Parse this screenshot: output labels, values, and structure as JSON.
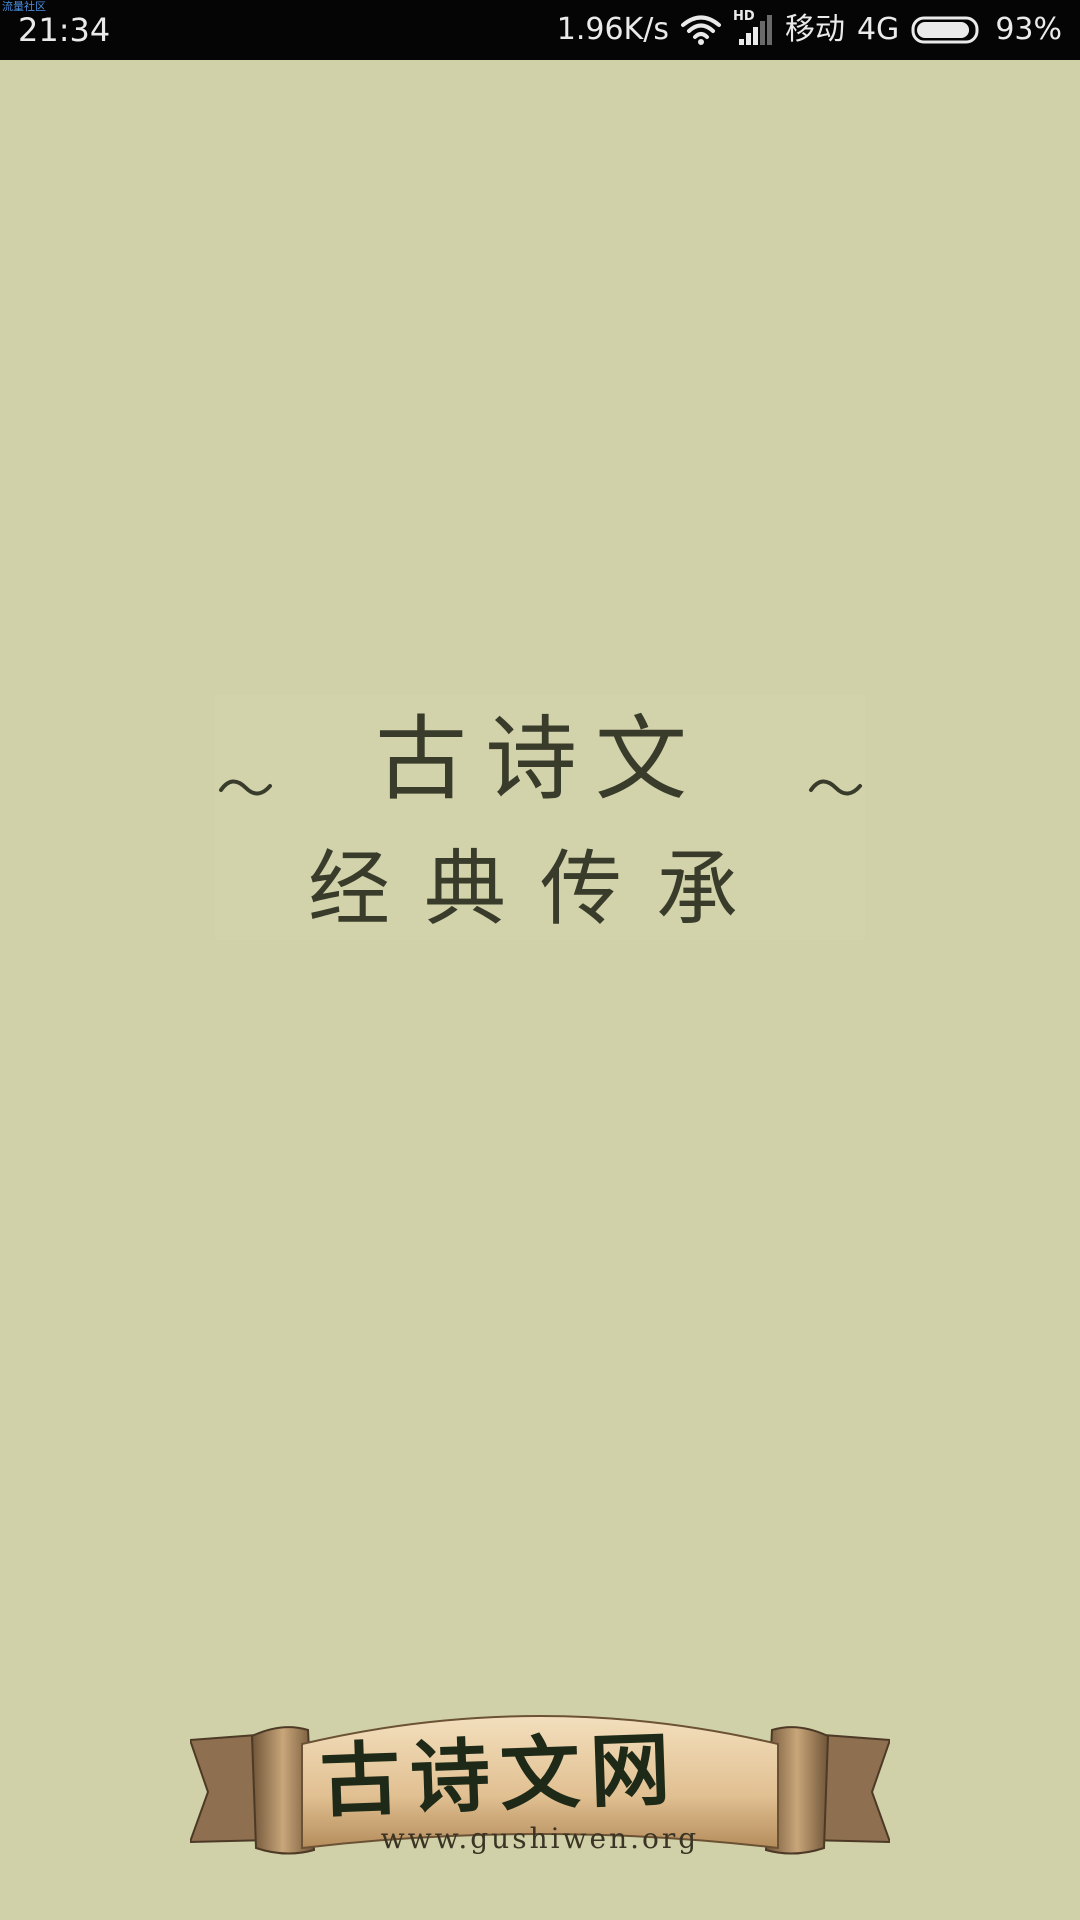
{
  "status_bar": {
    "watermark": "流量社区",
    "time": "21:34",
    "net_speed": "1.96K/s",
    "hd_label": "HD",
    "carrier": "移动",
    "network_type": "4G",
    "battery_percent": "93%",
    "battery_level": 0.93,
    "icons": [
      "wifi-icon",
      "signal-icon",
      "battery-icon"
    ]
  },
  "splash": {
    "title": "古诗文",
    "subtitle": "经典传承"
  },
  "logo": {
    "title": "古诗文网",
    "url": "www.gushiwen.org"
  },
  "colors": {
    "background": "#d0d1a8",
    "status_bar": "#050505",
    "title_text": "#3a3c2b",
    "banner_paper": "#e3c79c",
    "banner_text": "#1e2a17"
  }
}
